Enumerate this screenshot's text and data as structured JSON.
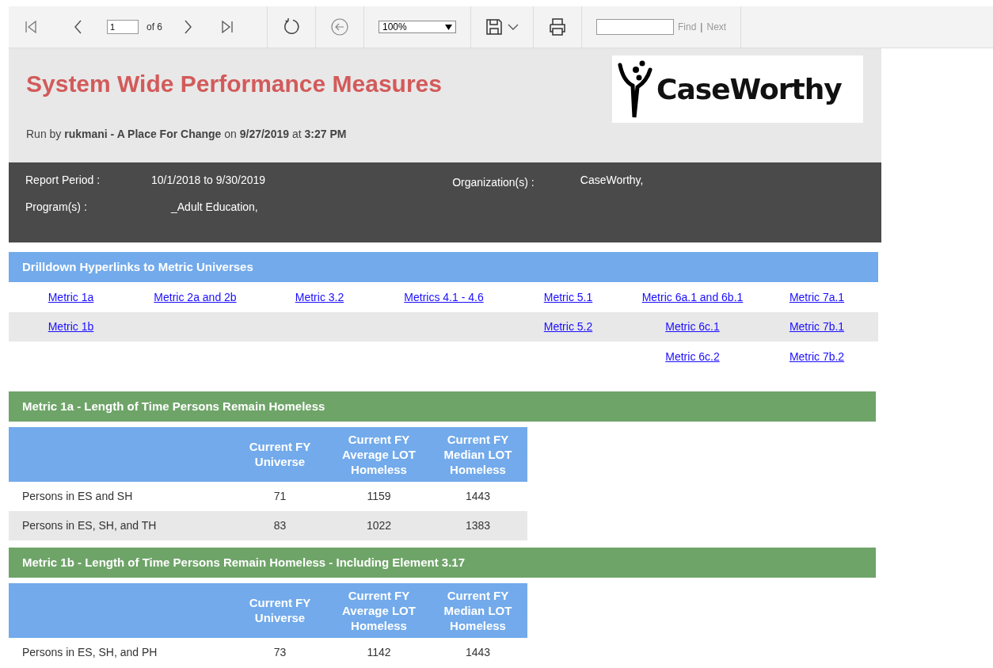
{
  "toolbar": {
    "page": "1",
    "page_count": "of 6",
    "zoom": "100%",
    "find_label": "Find",
    "separator": "|",
    "next_label": "Next",
    "find_disabled": true
  },
  "header": {
    "title": "System Wide Performance Measures",
    "run_by": "Run by **rukmani - A Place For Change** on **9/27/2019** at **3:27 PM**",
    "logo_text": "CaseWorthy"
  },
  "parameters": {
    "report_period_label": "Report Period :",
    "report_period": "10/1/2018 to 9/30/2019",
    "organization_label": "Organization(s) :",
    "organization": "CaseWorthy,",
    "program_label": "Program(s) :",
    "program": "_Adult Education,"
  },
  "drilldown": {
    "title": "Drilldown Hyperlinks to Metric Universes",
    "rows": [
      [
        "Metric 1a",
        "Metric 2a and 2b",
        "Metric 3.2",
        "Metrics 4.1 - 4.6",
        "Metric 5.1",
        "Metric 6a.1 and 6b.1",
        "Metric 7a.1"
      ],
      [
        "Metric 1b",
        null,
        null,
        null,
        "Metric 5.2",
        "Metric 6c.1",
        "Metric 7b.1"
      ],
      [
        null,
        null,
        null,
        null,
        null,
        "Metric 6c.2",
        "Metric 7b.2"
      ]
    ]
  },
  "sections": [
    {
      "title": "Metric 1a - Length of Time Persons Remain Homeless",
      "columns": [
        "Current FY Universe",
        "Current FY Average LOT Homeless",
        "Current FY Median LOT Homeless"
      ],
      "rows": [
        {
          "label": "Persons in ES and SH",
          "values": [
            "71",
            "1159",
            "1443"
          ]
        },
        {
          "label": "Persons in ES, SH, and TH",
          "values": [
            "83",
            "1022",
            "1383"
          ]
        }
      ]
    },
    {
      "title": "Metric 1b - Length of Time Persons Remain Homeless - Including Element 3.17",
      "columns": [
        "Current FY Universe",
        "Current FY Average LOT Homeless",
        "Current FY Median LOT Homeless"
      ],
      "rows": [
        {
          "label": "Persons in ES, SH, and PH",
          "values": [
            "73",
            "1142",
            "1443"
          ]
        }
      ]
    }
  ]
}
